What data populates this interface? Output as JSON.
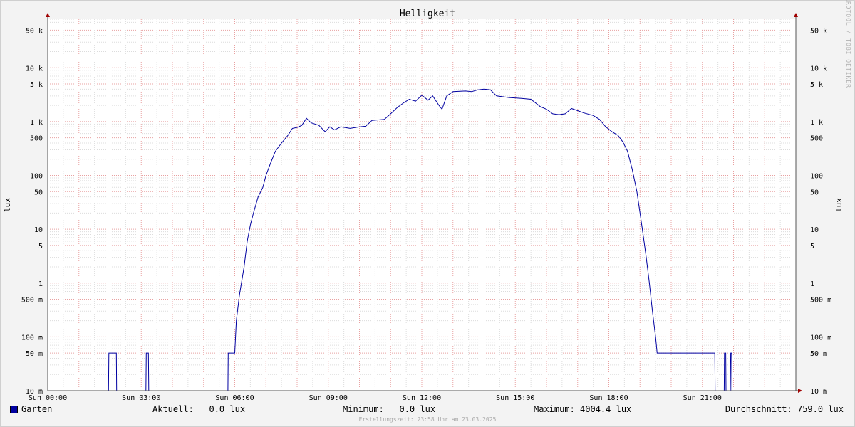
{
  "chart_data": {
    "type": "line",
    "title": "Helligkeit",
    "ylabel_left": "lux",
    "ylabel_right": "lux",
    "y_scale": "log",
    "ylim": [
      0.01,
      80000
    ],
    "xlim": [
      "00:00",
      "24:00"
    ],
    "grid": true,
    "y_tick_labels": [
      {
        "value": 0.01,
        "label": "10 m"
      },
      {
        "value": 0.05,
        "label": "50 m"
      },
      {
        "value": 0.1,
        "label": "100 m"
      },
      {
        "value": 0.5,
        "label": "500 m"
      },
      {
        "value": 1,
        "label": "1"
      },
      {
        "value": 5,
        "label": "5"
      },
      {
        "value": 10,
        "label": "10"
      },
      {
        "value": 50,
        "label": "50"
      },
      {
        "value": 100,
        "label": "100"
      },
      {
        "value": 500,
        "label": "500"
      },
      {
        "value": 1000,
        "label": "1 k"
      },
      {
        "value": 5000,
        "label": "5 k"
      },
      {
        "value": 10000,
        "label": "10 k"
      },
      {
        "value": 50000,
        "label": "50 k"
      }
    ],
    "x_tick_labels": [
      {
        "hour": 0,
        "label": "Sun 00:00"
      },
      {
        "hour": 3,
        "label": "Sun 03:00"
      },
      {
        "hour": 6,
        "label": "Sun 06:00"
      },
      {
        "hour": 9,
        "label": "Sun 09:00"
      },
      {
        "hour": 12,
        "label": "Sun 12:00"
      },
      {
        "hour": 15,
        "label": "Sun 15:00"
      },
      {
        "hour": 18,
        "label": "Sun 18:00"
      },
      {
        "hour": 21,
        "label": "Sun 21:00"
      }
    ],
    "series": [
      {
        "name": "Garten",
        "color": "#0000a0",
        "points": [
          [
            0.0,
            0.01
          ],
          [
            1.95,
            0.01
          ],
          [
            1.96,
            0.05
          ],
          [
            2.2,
            0.05
          ],
          [
            2.21,
            0.01
          ],
          [
            3.15,
            0.01
          ],
          [
            3.16,
            0.05
          ],
          [
            3.23,
            0.05
          ],
          [
            3.24,
            0.01
          ],
          [
            5.78,
            0.01
          ],
          [
            5.79,
            0.05
          ],
          [
            6.0,
            0.05
          ],
          [
            6.05,
            0.2
          ],
          [
            6.15,
            0.6
          ],
          [
            6.3,
            2
          ],
          [
            6.4,
            6
          ],
          [
            6.5,
            12
          ],
          [
            6.6,
            20
          ],
          [
            6.75,
            40
          ],
          [
            6.9,
            60
          ],
          [
            7.0,
            100
          ],
          [
            7.15,
            170
          ],
          [
            7.3,
            280
          ],
          [
            7.5,
            400
          ],
          [
            7.7,
            550
          ],
          [
            7.85,
            750
          ],
          [
            8.0,
            780
          ],
          [
            8.15,
            850
          ],
          [
            8.3,
            1150
          ],
          [
            8.45,
            950
          ],
          [
            8.7,
            850
          ],
          [
            8.9,
            650
          ],
          [
            9.05,
            800
          ],
          [
            9.2,
            700
          ],
          [
            9.4,
            800
          ],
          [
            9.7,
            750
          ],
          [
            10.0,
            800
          ],
          [
            10.2,
            820
          ],
          [
            10.4,
            1050
          ],
          [
            10.8,
            1100
          ],
          [
            11.0,
            1400
          ],
          [
            11.2,
            1800
          ],
          [
            11.4,
            2200
          ],
          [
            11.6,
            2600
          ],
          [
            11.8,
            2400
          ],
          [
            12.0,
            3100
          ],
          [
            12.2,
            2500
          ],
          [
            12.35,
            3000
          ],
          [
            12.55,
            2000
          ],
          [
            12.65,
            1700
          ],
          [
            12.8,
            3000
          ],
          [
            13.0,
            3600
          ],
          [
            13.4,
            3700
          ],
          [
            13.6,
            3600
          ],
          [
            13.8,
            3900
          ],
          [
            14.0,
            4004
          ],
          [
            14.2,
            3900
          ],
          [
            14.4,
            3000
          ],
          [
            14.8,
            2800
          ],
          [
            15.2,
            2700
          ],
          [
            15.5,
            2600
          ],
          [
            15.8,
            1900
          ],
          [
            16.0,
            1700
          ],
          [
            16.2,
            1400
          ],
          [
            16.4,
            1350
          ],
          [
            16.6,
            1400
          ],
          [
            16.8,
            1750
          ],
          [
            17.0,
            1600
          ],
          [
            17.2,
            1450
          ],
          [
            17.5,
            1300
          ],
          [
            17.7,
            1100
          ],
          [
            17.9,
            800
          ],
          [
            18.1,
            650
          ],
          [
            18.3,
            550
          ],
          [
            18.45,
            420
          ],
          [
            18.6,
            280
          ],
          [
            18.75,
            130
          ],
          [
            18.9,
            50
          ],
          [
            19.0,
            20
          ],
          [
            19.1,
            8
          ],
          [
            19.2,
            3
          ],
          [
            19.3,
            1
          ],
          [
            19.4,
            0.3
          ],
          [
            19.5,
            0.1
          ],
          [
            19.55,
            0.05
          ],
          [
            20.0,
            0.05
          ],
          [
            21.0,
            0.05
          ],
          [
            21.4,
            0.05
          ],
          [
            21.41,
            0.01
          ],
          [
            21.7,
            0.01
          ],
          [
            21.71,
            0.05
          ],
          [
            21.75,
            0.05
          ],
          [
            21.76,
            0.01
          ],
          [
            21.9,
            0.01
          ],
          [
            21.91,
            0.05
          ],
          [
            21.94,
            0.05
          ],
          [
            21.95,
            0.01
          ],
          [
            24.0,
            0.01
          ]
        ]
      }
    ]
  },
  "legend": {
    "series_name": "Garten",
    "aktuell": "Aktuell:   0.0 lux",
    "minimum": "Minimum:   0.0 lux",
    "maximum": "Maximum: 4004.4 lux",
    "durchschnitt": "Durchschnitt: 759.0 lux"
  },
  "watermark": "RRDTOOL / TOBI OETIKER",
  "footer": "Erstellungszeit: 23:58 Uhr am 23.03.2025"
}
